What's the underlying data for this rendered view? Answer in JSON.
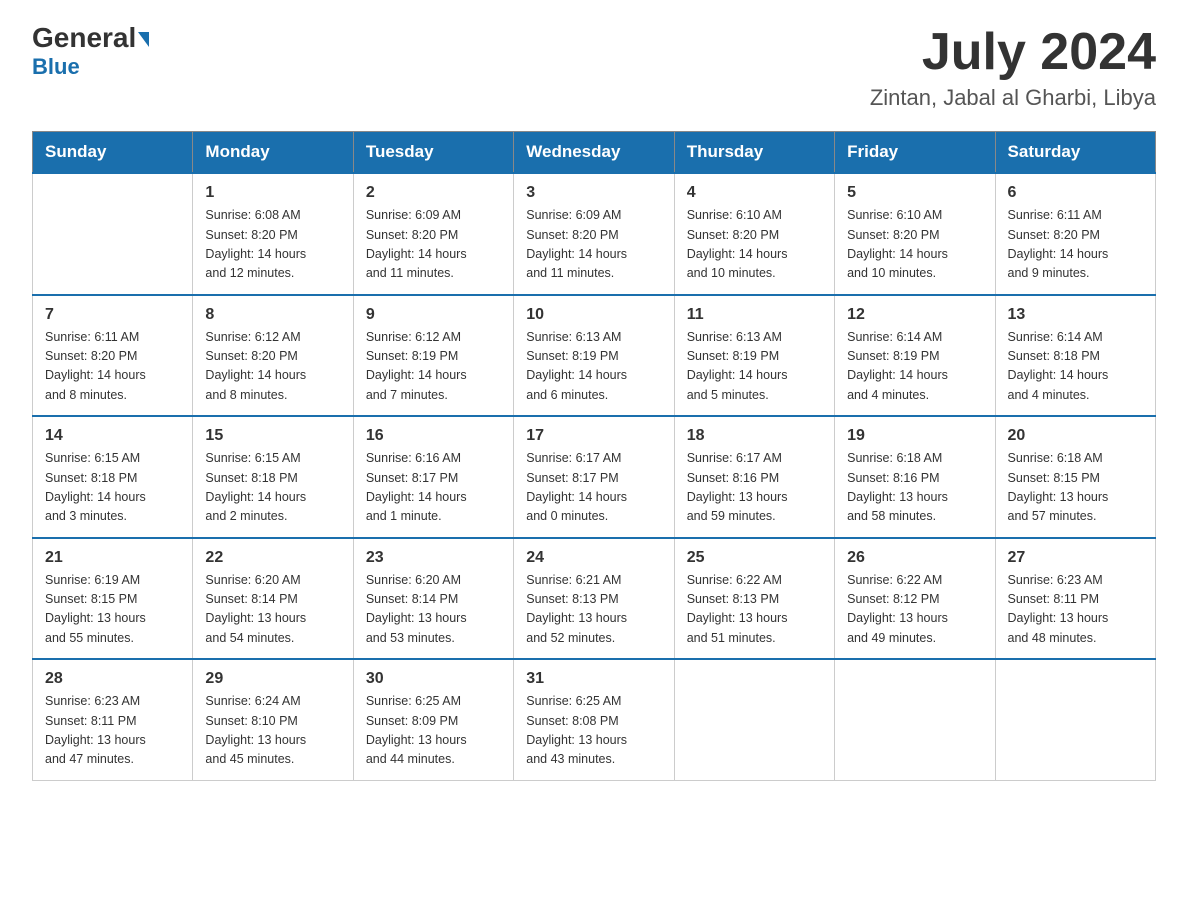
{
  "header": {
    "logo_general": "General",
    "logo_blue": "Blue",
    "month_title": "July 2024",
    "location": "Zintan, Jabal al Gharbi, Libya"
  },
  "days_of_week": [
    "Sunday",
    "Monday",
    "Tuesday",
    "Wednesday",
    "Thursday",
    "Friday",
    "Saturday"
  ],
  "weeks": [
    [
      {
        "day": "",
        "info": ""
      },
      {
        "day": "1",
        "info": "Sunrise: 6:08 AM\nSunset: 8:20 PM\nDaylight: 14 hours\nand 12 minutes."
      },
      {
        "day": "2",
        "info": "Sunrise: 6:09 AM\nSunset: 8:20 PM\nDaylight: 14 hours\nand 11 minutes."
      },
      {
        "day": "3",
        "info": "Sunrise: 6:09 AM\nSunset: 8:20 PM\nDaylight: 14 hours\nand 11 minutes."
      },
      {
        "day": "4",
        "info": "Sunrise: 6:10 AM\nSunset: 8:20 PM\nDaylight: 14 hours\nand 10 minutes."
      },
      {
        "day": "5",
        "info": "Sunrise: 6:10 AM\nSunset: 8:20 PM\nDaylight: 14 hours\nand 10 minutes."
      },
      {
        "day": "6",
        "info": "Sunrise: 6:11 AM\nSunset: 8:20 PM\nDaylight: 14 hours\nand 9 minutes."
      }
    ],
    [
      {
        "day": "7",
        "info": "Sunrise: 6:11 AM\nSunset: 8:20 PM\nDaylight: 14 hours\nand 8 minutes."
      },
      {
        "day": "8",
        "info": "Sunrise: 6:12 AM\nSunset: 8:20 PM\nDaylight: 14 hours\nand 8 minutes."
      },
      {
        "day": "9",
        "info": "Sunrise: 6:12 AM\nSunset: 8:19 PM\nDaylight: 14 hours\nand 7 minutes."
      },
      {
        "day": "10",
        "info": "Sunrise: 6:13 AM\nSunset: 8:19 PM\nDaylight: 14 hours\nand 6 minutes."
      },
      {
        "day": "11",
        "info": "Sunrise: 6:13 AM\nSunset: 8:19 PM\nDaylight: 14 hours\nand 5 minutes."
      },
      {
        "day": "12",
        "info": "Sunrise: 6:14 AM\nSunset: 8:19 PM\nDaylight: 14 hours\nand 4 minutes."
      },
      {
        "day": "13",
        "info": "Sunrise: 6:14 AM\nSunset: 8:18 PM\nDaylight: 14 hours\nand 4 minutes."
      }
    ],
    [
      {
        "day": "14",
        "info": "Sunrise: 6:15 AM\nSunset: 8:18 PM\nDaylight: 14 hours\nand 3 minutes."
      },
      {
        "day": "15",
        "info": "Sunrise: 6:15 AM\nSunset: 8:18 PM\nDaylight: 14 hours\nand 2 minutes."
      },
      {
        "day": "16",
        "info": "Sunrise: 6:16 AM\nSunset: 8:17 PM\nDaylight: 14 hours\nand 1 minute."
      },
      {
        "day": "17",
        "info": "Sunrise: 6:17 AM\nSunset: 8:17 PM\nDaylight: 14 hours\nand 0 minutes."
      },
      {
        "day": "18",
        "info": "Sunrise: 6:17 AM\nSunset: 8:16 PM\nDaylight: 13 hours\nand 59 minutes."
      },
      {
        "day": "19",
        "info": "Sunrise: 6:18 AM\nSunset: 8:16 PM\nDaylight: 13 hours\nand 58 minutes."
      },
      {
        "day": "20",
        "info": "Sunrise: 6:18 AM\nSunset: 8:15 PM\nDaylight: 13 hours\nand 57 minutes."
      }
    ],
    [
      {
        "day": "21",
        "info": "Sunrise: 6:19 AM\nSunset: 8:15 PM\nDaylight: 13 hours\nand 55 minutes."
      },
      {
        "day": "22",
        "info": "Sunrise: 6:20 AM\nSunset: 8:14 PM\nDaylight: 13 hours\nand 54 minutes."
      },
      {
        "day": "23",
        "info": "Sunrise: 6:20 AM\nSunset: 8:14 PM\nDaylight: 13 hours\nand 53 minutes."
      },
      {
        "day": "24",
        "info": "Sunrise: 6:21 AM\nSunset: 8:13 PM\nDaylight: 13 hours\nand 52 minutes."
      },
      {
        "day": "25",
        "info": "Sunrise: 6:22 AM\nSunset: 8:13 PM\nDaylight: 13 hours\nand 51 minutes."
      },
      {
        "day": "26",
        "info": "Sunrise: 6:22 AM\nSunset: 8:12 PM\nDaylight: 13 hours\nand 49 minutes."
      },
      {
        "day": "27",
        "info": "Sunrise: 6:23 AM\nSunset: 8:11 PM\nDaylight: 13 hours\nand 48 minutes."
      }
    ],
    [
      {
        "day": "28",
        "info": "Sunrise: 6:23 AM\nSunset: 8:11 PM\nDaylight: 13 hours\nand 47 minutes."
      },
      {
        "day": "29",
        "info": "Sunrise: 6:24 AM\nSunset: 8:10 PM\nDaylight: 13 hours\nand 45 minutes."
      },
      {
        "day": "30",
        "info": "Sunrise: 6:25 AM\nSunset: 8:09 PM\nDaylight: 13 hours\nand 44 minutes."
      },
      {
        "day": "31",
        "info": "Sunrise: 6:25 AM\nSunset: 8:08 PM\nDaylight: 13 hours\nand 43 minutes."
      },
      {
        "day": "",
        "info": ""
      },
      {
        "day": "",
        "info": ""
      },
      {
        "day": "",
        "info": ""
      }
    ]
  ]
}
